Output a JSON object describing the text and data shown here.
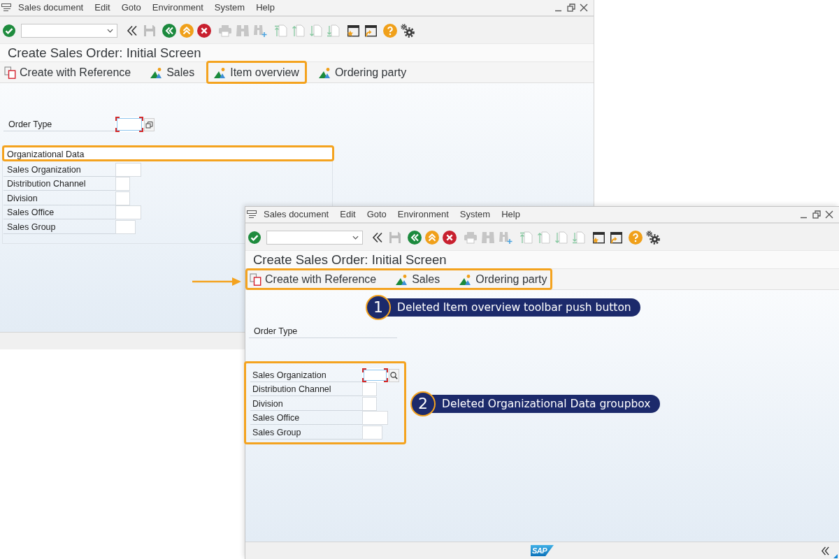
{
  "windows": [
    {
      "menu": [
        "Sales document",
        "Edit",
        "Goto",
        "Environment",
        "System",
        "Help"
      ],
      "title": "Create Sales Order: Initial Screen",
      "app_toolbar": {
        "highlighted": false,
        "buttons": [
          {
            "label": "Create with Reference",
            "kind": "reference",
            "highlighted": false
          },
          {
            "label": "Sales",
            "kind": "view",
            "highlighted": false
          },
          {
            "label": "Item overview",
            "kind": "view",
            "highlighted": true
          },
          {
            "label": "Ordering party",
            "kind": "view",
            "highlighted": false
          }
        ]
      },
      "order_type": {
        "label": "Order Type",
        "field": {
          "focused": true,
          "help_button": {
            "kind": "multiselect"
          }
        }
      },
      "org_data": {
        "kind": "groupbox",
        "title": "Organizational Data",
        "highlighted": true,
        "fields": [
          {
            "label": "Sales Organization",
            "focused": false
          },
          {
            "label": "Distribution Channel",
            "focused": false
          },
          {
            "label": "Division",
            "focused": false
          },
          {
            "label": "Sales Office",
            "focused": false
          },
          {
            "label": "Sales Group",
            "focused": false
          }
        ]
      }
    },
    {
      "menu": [
        "Sales document",
        "Edit",
        "Goto",
        "Environment",
        "System",
        "Help"
      ],
      "title": "Create Sales Order: Initial Screen",
      "app_toolbar": {
        "highlighted": true,
        "buttons": [
          {
            "label": "Create with Reference",
            "kind": "reference",
            "highlighted": false
          },
          {
            "label": "Sales",
            "kind": "view",
            "highlighted": false
          },
          {
            "label": "Ordering party",
            "kind": "view",
            "highlighted": false
          }
        ]
      },
      "order_type": {
        "label": "Order Type"
      },
      "org_data": {
        "kind": "plain",
        "highlighted": true,
        "fields": [
          {
            "label": "Sales Organization",
            "focused": true,
            "help_button": {
              "kind": "search"
            }
          },
          {
            "label": "Distribution Channel",
            "focused": false
          },
          {
            "label": "Division",
            "focused": false
          },
          {
            "label": "Sales Office",
            "focused": false
          },
          {
            "label": "Sales Group",
            "focused": false
          }
        ]
      },
      "status_bar": {
        "logo": "SAP"
      }
    }
  ],
  "annotations": [
    {
      "number": "1",
      "text": "Deleted Item overview toolbar push button"
    },
    {
      "number": "2",
      "text": "Deleted Organizational Data groupbox"
    }
  ]
}
